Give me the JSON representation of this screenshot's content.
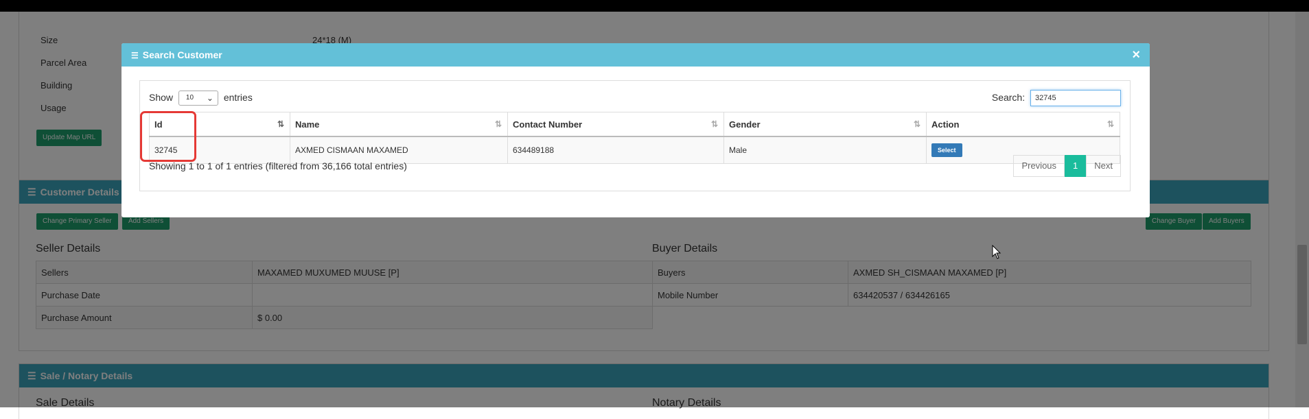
{
  "property_details": {
    "rows": [
      {
        "label": "Size",
        "value": "24*18 (M)"
      },
      {
        "label": "Parcel Area",
        "value": ""
      },
      {
        "label": "Building",
        "value": ""
      },
      {
        "label": "Usage",
        "value": ""
      }
    ],
    "update_map_url_button": "Update Map URL"
  },
  "customer_details": {
    "title": "Customer Details",
    "change_primary_seller_button": "Change Primary Seller",
    "add_sellers_button": "Add Sellers",
    "change_buyer_button": "Change Buyer",
    "add_buyers_button": "Add Buyers",
    "seller": {
      "title": "Seller Details",
      "rows": [
        {
          "label": "Sellers",
          "value": "MAXAMED MUXUMED MUUSE [P]"
        },
        {
          "label": "Purchase Date",
          "value": ""
        },
        {
          "label": "Purchase Amount",
          "value": "$ 0.00"
        }
      ]
    },
    "buyer": {
      "title": "Buyer Details",
      "rows": [
        {
          "label": "Buyers",
          "value": "AXMED SH_CISMAAN MAXAMED [P]"
        },
        {
          "label": "Mobile Number",
          "value": "634420537 / 634426165"
        }
      ]
    }
  },
  "sale_notary": {
    "title": "Sale / Notary Details",
    "sale_title": "Sale Details",
    "notary_title": "Notary Details"
  },
  "modal": {
    "title": "Search Customer",
    "close_glyph": "×",
    "show_label": "Show",
    "page_size": "10",
    "entries_label": "entries",
    "search_label": "Search:",
    "search_value": "32745",
    "columns": [
      "Id",
      "Name",
      "Contact Number",
      "Gender",
      "Action"
    ],
    "rows": [
      {
        "id": "32745",
        "name": "AXMED CISMAAN MAXAMED",
        "contact": "634489188",
        "gender": "Male",
        "action": "Select"
      }
    ],
    "info": "Showing 1 to 1 of 1 entries (filtered from 36,166 total entries)",
    "pagination": {
      "previous": "Previous",
      "current": "1",
      "next": "Next"
    }
  },
  "colors": {
    "modal_header": "#63c0d8",
    "panel_header": "#3aa4bd",
    "green_button": "#1f9e6c",
    "select_button": "#337ab7",
    "active_page": "#1abc9c",
    "highlight": "#e53935"
  }
}
